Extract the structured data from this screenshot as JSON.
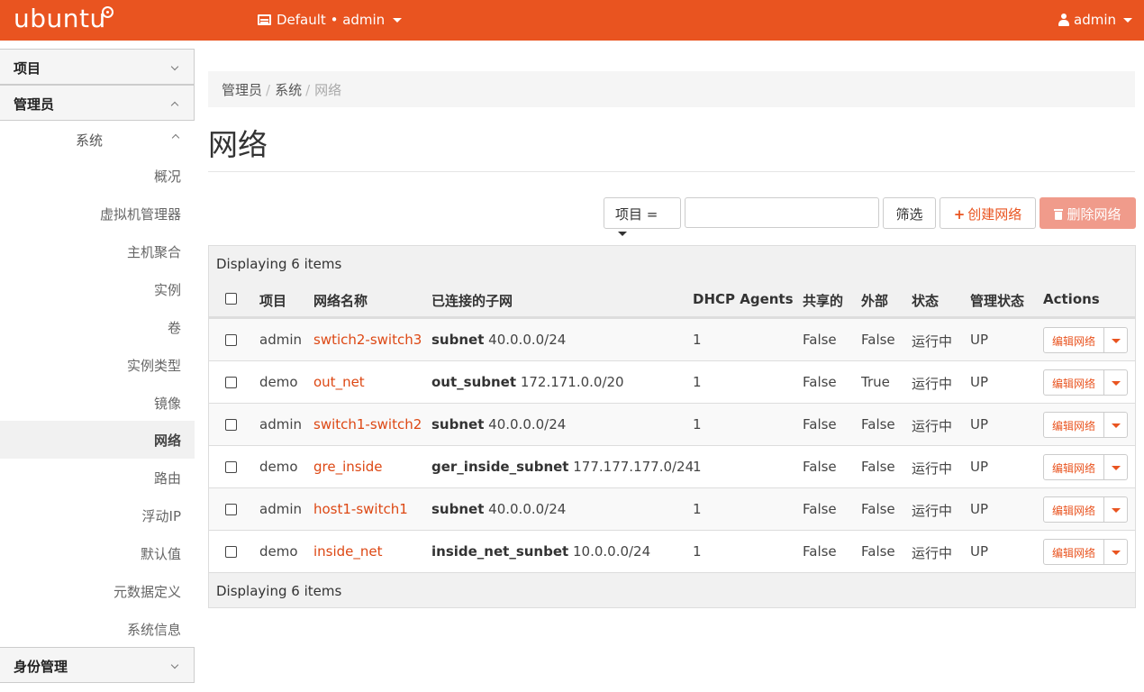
{
  "topbar": {
    "logo": "ubuntu",
    "project_switcher": "Default • admin",
    "user": "admin",
    "accent": "#e95420"
  },
  "sidebar": {
    "sections": [
      {
        "label": "项目",
        "expanded": false
      },
      {
        "label": "管理员",
        "expanded": true
      },
      {
        "label": "身份管理",
        "expanded": false
      }
    ],
    "subgroup": {
      "label": "系统",
      "expanded": true
    },
    "items": [
      {
        "label": "概况",
        "active": false
      },
      {
        "label": "虚拟机管理器",
        "active": false
      },
      {
        "label": "主机聚合",
        "active": false
      },
      {
        "label": "实例",
        "active": false
      },
      {
        "label": "卷",
        "active": false
      },
      {
        "label": "实例类型",
        "active": false
      },
      {
        "label": "镜像",
        "active": false
      },
      {
        "label": "网络",
        "active": true
      },
      {
        "label": "路由",
        "active": false
      },
      {
        "label": "浮动IP",
        "active": false
      },
      {
        "label": "默认值",
        "active": false
      },
      {
        "label": "元数据定义",
        "active": false
      },
      {
        "label": "系统信息",
        "active": false
      }
    ]
  },
  "breadcrumb": [
    "管理员",
    "系统",
    "网络"
  ],
  "breadcrumb_sep": "/",
  "page_title": "网络",
  "filter": {
    "field_label": "项目 =",
    "input_value": "",
    "filter_button": "筛选",
    "create_button": "创建网络",
    "delete_button": "删除网络",
    "plus_glyph": "+"
  },
  "table": {
    "caption": "Displaying 6 items",
    "footer": "Displaying 6 items",
    "columns": [
      "项目",
      "网络名称",
      "已连接的子网",
      "DHCP Agents",
      "共享的",
      "外部",
      "状态",
      "管理状态",
      "Actions"
    ],
    "rows": [
      {
        "project": "admin",
        "name": "swtich2-switch3",
        "subnet_name": "subnet",
        "subnet_cidr": "40.0.0.0/24",
        "dhcp": "1",
        "shared": "False",
        "external": "False",
        "status": "运行中",
        "admin_state": "UP",
        "action": "编辑网络"
      },
      {
        "project": "demo",
        "name": "out_net",
        "subnet_name": "out_subnet",
        "subnet_cidr": "172.171.0.0/20",
        "dhcp": "1",
        "shared": "False",
        "external": "True",
        "status": "运行中",
        "admin_state": "UP",
        "action": "编辑网络"
      },
      {
        "project": "admin",
        "name": "switch1-switch2",
        "subnet_name": "subnet",
        "subnet_cidr": "40.0.0.0/24",
        "dhcp": "1",
        "shared": "False",
        "external": "False",
        "status": "运行中",
        "admin_state": "UP",
        "action": "编辑网络"
      },
      {
        "project": "demo",
        "name": "gre_inside",
        "subnet_name": "ger_inside_subnet",
        "subnet_cidr": "177.177.177.0/24",
        "dhcp": "1",
        "shared": "False",
        "external": "False",
        "status": "运行中",
        "admin_state": "UP",
        "action": "编辑网络"
      },
      {
        "project": "admin",
        "name": "host1-switch1",
        "subnet_name": "subnet",
        "subnet_cidr": "40.0.0.0/24",
        "dhcp": "1",
        "shared": "False",
        "external": "False",
        "status": "运行中",
        "admin_state": "UP",
        "action": "编辑网络"
      },
      {
        "project": "demo",
        "name": "inside_net",
        "subnet_name": "inside_net_sunbet",
        "subnet_cidr": "10.0.0.0/24",
        "dhcp": "1",
        "shared": "False",
        "external": "False",
        "status": "运行中",
        "admin_state": "UP",
        "action": "编辑网络"
      }
    ]
  }
}
